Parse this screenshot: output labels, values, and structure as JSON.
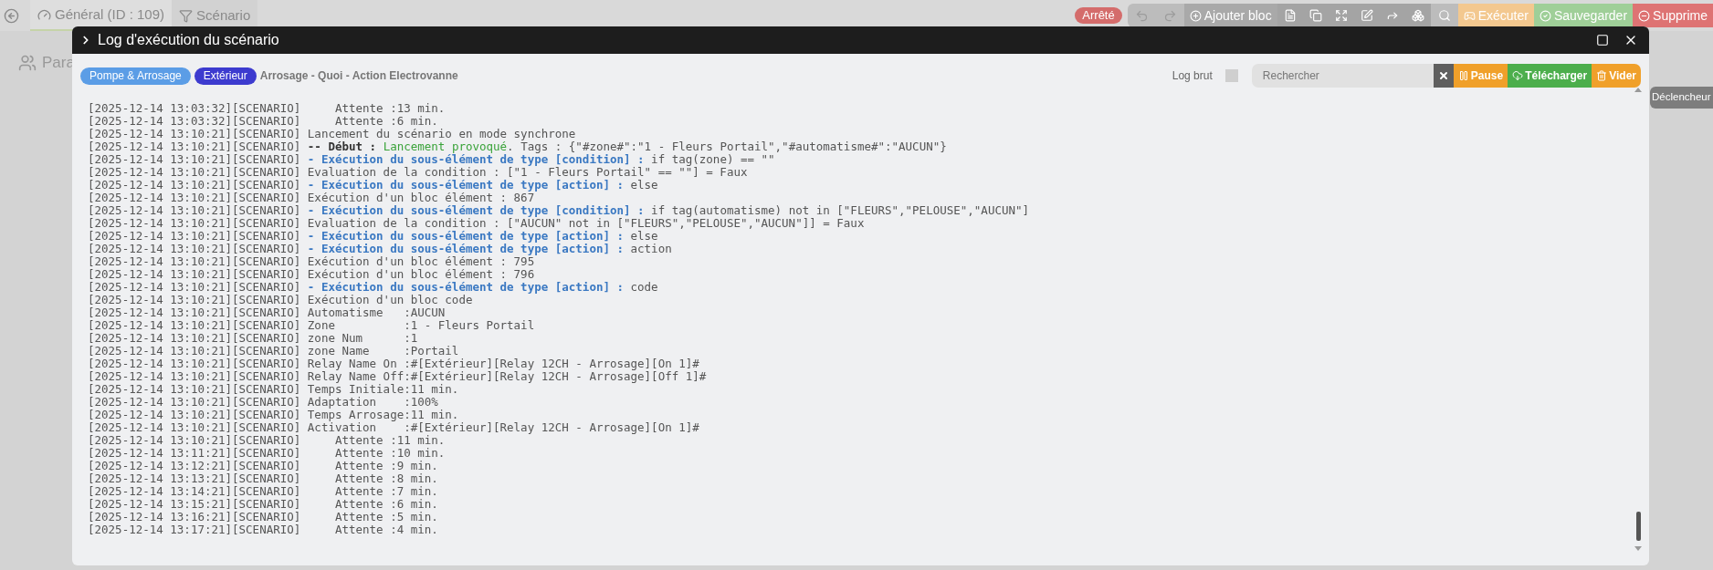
{
  "nav": {
    "tabs": [
      {
        "label": "Général (ID : 109)",
        "selected": true
      },
      {
        "label": "Scénario",
        "selected": false
      }
    ]
  },
  "status_badge": "Arrêté",
  "toolbar": {
    "add_label": "Ajouter bloc",
    "actions": [
      {
        "label": "Exécuter",
        "color": "#f3c88f"
      },
      {
        "label": "Sauvegarder",
        "color": "#9fcf98"
      },
      {
        "label": "Supprime",
        "color": "#de7373"
      }
    ]
  },
  "background": {
    "section_title": "Para",
    "trigger_button": "Déclencheur"
  },
  "modal": {
    "title": "Log d'exécution du scénario",
    "tags": [
      {
        "label": "Pompe & Arrosage",
        "color": "#5b9de6"
      },
      {
        "label": "Extérieur",
        "color": "#3d3bcf"
      }
    ],
    "scenario_name": "Arrosage - Quoi - Action Electrovanne",
    "raw_log": {
      "label": "Log brut",
      "checked": false
    },
    "search": {
      "placeholder": "Rechercher"
    },
    "buttons": [
      {
        "label": "Pause",
        "color": "#f0a02a"
      },
      {
        "label": "Télécharger",
        "color": "#4cae4c"
      },
      {
        "label": "Vider",
        "color": "#f0a02a"
      }
    ],
    "log_lines": [
      {
        "stamp": "[2025-12-14 13:03:32][SCENARIO]",
        "kind": "plain",
        "text": "    Attente :13 min."
      },
      {
        "stamp": "[2025-12-14 13:03:32][SCENARIO]",
        "kind": "plain",
        "text": "    Attente :6 min."
      },
      {
        "stamp": "[2025-12-14 13:10:21][SCENARIO]",
        "kind": "plain",
        "text": "Lancement du scénario en mode synchrone"
      },
      {
        "stamp": "[2025-12-14 13:10:21][SCENARIO]",
        "kind": "start",
        "head": "-- Début :",
        "highlight": "Lancement provoqué",
        "text": ". Tags : {\"#zone#\":\"1 - Fleurs Portail\",\"#automatisme#\":\"AUCUN\"}"
      },
      {
        "stamp": "[2025-12-14 13:10:21][SCENARIO]",
        "kind": "step",
        "head": "- Exécution du sous-élément de type [condition] :",
        "text": " if tag(zone) == \"\""
      },
      {
        "stamp": "[2025-12-14 13:10:21][SCENARIO]",
        "kind": "plain",
        "text": "Evaluation de la condition : [\"1 - Fleurs Portail\" == \"\"] = Faux"
      },
      {
        "stamp": "[2025-12-14 13:10:21][SCENARIO]",
        "kind": "step",
        "head": "- Exécution du sous-élément de type [action] :",
        "text": " else"
      },
      {
        "stamp": "[2025-12-14 13:10:21][SCENARIO]",
        "kind": "plain",
        "text": "Exécution d'un bloc élément : 867"
      },
      {
        "stamp": "[2025-12-14 13:10:21][SCENARIO]",
        "kind": "step",
        "head": "- Exécution du sous-élément de type [condition] :",
        "text": " if tag(automatisme) not in [\"FLEURS\",\"PELOUSE\",\"AUCUN\"]"
      },
      {
        "stamp": "[2025-12-14 13:10:21][SCENARIO]",
        "kind": "plain",
        "text": "Evaluation de la condition : [\"AUCUN\" not in [\"FLEURS\",\"PELOUSE\",\"AUCUN\"]] = Faux"
      },
      {
        "stamp": "[2025-12-14 13:10:21][SCENARIO]",
        "kind": "step",
        "head": "- Exécution du sous-élément de type [action] :",
        "text": " else"
      },
      {
        "stamp": "[2025-12-14 13:10:21][SCENARIO]",
        "kind": "step",
        "head": "- Exécution du sous-élément de type [action] :",
        "text": " action"
      },
      {
        "stamp": "[2025-12-14 13:10:21][SCENARIO]",
        "kind": "plain",
        "text": "Exécution d'un bloc élément : 795"
      },
      {
        "stamp": "[2025-12-14 13:10:21][SCENARIO]",
        "kind": "plain",
        "text": "Exécution d'un bloc élément : 796"
      },
      {
        "stamp": "[2025-12-14 13:10:21][SCENARIO]",
        "kind": "step",
        "head": "- Exécution du sous-élément de type [action] :",
        "text": " code"
      },
      {
        "stamp": "[2025-12-14 13:10:21][SCENARIO]",
        "kind": "plain",
        "text": "Exécution d'un bloc code"
      },
      {
        "stamp": "[2025-12-14 13:10:21][SCENARIO]",
        "kind": "plain",
        "text": "Automatisme   :AUCUN"
      },
      {
        "stamp": "[2025-12-14 13:10:21][SCENARIO]",
        "kind": "plain",
        "text": "Zone          :1 - Fleurs Portail"
      },
      {
        "stamp": "[2025-12-14 13:10:21][SCENARIO]",
        "kind": "plain",
        "text": "zone Num      :1"
      },
      {
        "stamp": "[2025-12-14 13:10:21][SCENARIO]",
        "kind": "plain",
        "text": "zone Name     :Portail"
      },
      {
        "stamp": "[2025-12-14 13:10:21][SCENARIO]",
        "kind": "plain",
        "text": "Relay Name On :#[Extérieur][Relay 12CH - Arrosage][On 1]#"
      },
      {
        "stamp": "[2025-12-14 13:10:21][SCENARIO]",
        "kind": "plain",
        "text": "Relay Name Off:#[Extérieur][Relay 12CH - Arrosage][Off 1]#"
      },
      {
        "stamp": "[2025-12-14 13:10:21][SCENARIO]",
        "kind": "plain",
        "text": "Temps Initiale:11 min."
      },
      {
        "stamp": "[2025-12-14 13:10:21][SCENARIO]",
        "kind": "plain",
        "text": "Adaptation    :100%"
      },
      {
        "stamp": "[2025-12-14 13:10:21][SCENARIO]",
        "kind": "plain",
        "text": "Temps Arrosage:11 min."
      },
      {
        "stamp": "[2025-12-14 13:10:21][SCENARIO]",
        "kind": "plain",
        "text": "Activation    :#[Extérieur][Relay 12CH - Arrosage][On 1]#"
      },
      {
        "stamp": "[2025-12-14 13:10:21][SCENARIO]",
        "kind": "plain",
        "text": "    Attente :11 min."
      },
      {
        "stamp": "[2025-12-14 13:11:21][SCENARIO]",
        "kind": "plain",
        "text": "    Attente :10 min."
      },
      {
        "stamp": "[2025-12-14 13:12:21][SCENARIO]",
        "kind": "plain",
        "text": "    Attente :9 min."
      },
      {
        "stamp": "[2025-12-14 13:13:21][SCENARIO]",
        "kind": "plain",
        "text": "    Attente :8 min."
      },
      {
        "stamp": "[2025-12-14 13:14:21][SCENARIO]",
        "kind": "plain",
        "text": "    Attente :7 min."
      },
      {
        "stamp": "[2025-12-14 13:15:21][SCENARIO]",
        "kind": "plain",
        "text": "    Attente :6 min."
      },
      {
        "stamp": "[2025-12-14 13:16:21][SCENARIO]",
        "kind": "plain",
        "text": "    Attente :5 min."
      },
      {
        "stamp": "[2025-12-14 13:17:21][SCENARIO]",
        "kind": "plain",
        "text": "    Attente :4 min."
      }
    ]
  }
}
